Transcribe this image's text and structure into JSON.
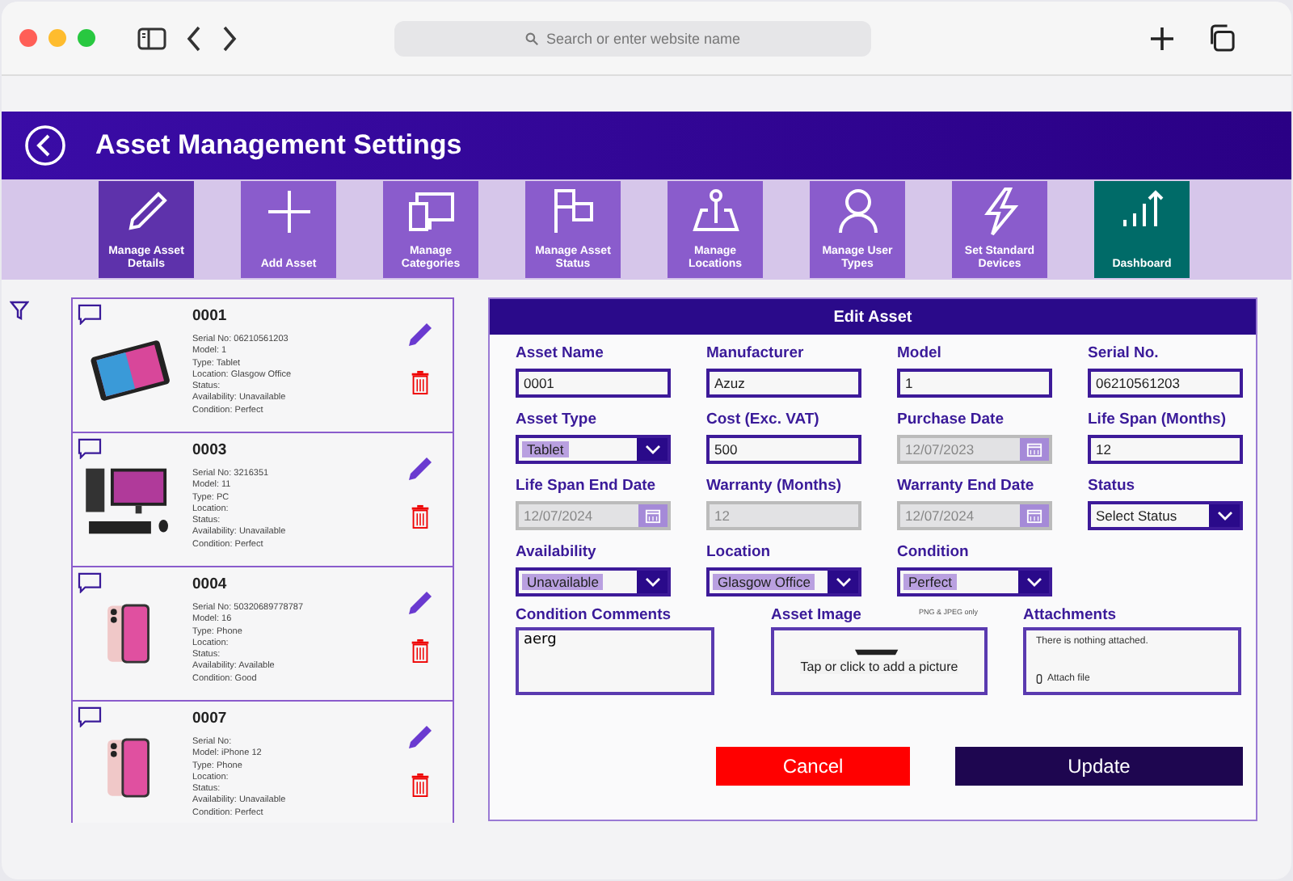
{
  "browser": {
    "address_placeholder": "Search or enter website name"
  },
  "header": {
    "title": "Asset Management Settings"
  },
  "nav": [
    {
      "label": "Manage Asset Details",
      "selected": true,
      "color": "#8a5ccc"
    },
    {
      "label": "Add Asset",
      "selected": false,
      "color": "#8a5ccc"
    },
    {
      "label": "Manage Categories",
      "selected": false,
      "color": "#8a5ccc"
    },
    {
      "label": "Manage Asset Status",
      "selected": false,
      "color": "#8a5ccc"
    },
    {
      "label": "Manage Locations",
      "selected": false,
      "color": "#8a5ccc"
    },
    {
      "label": "Manage User Types",
      "selected": false,
      "color": "#8a5ccc"
    },
    {
      "label": "Set Standard Devices",
      "selected": false,
      "color": "#8a5ccc"
    },
    {
      "label": "Dashboard",
      "selected": false,
      "color": "#006b68"
    }
  ],
  "assets": [
    {
      "id": "0001",
      "kind": "tablet",
      "details": [
        "Serial No: 06210561203",
        "Model: 1",
        "Type: Tablet",
        "Location: Glasgow Office",
        "Status:",
        "Availability: Unavailable",
        "Condition: Perfect"
      ]
    },
    {
      "id": "0003",
      "kind": "pc",
      "details": [
        "Serial No: 3216351",
        "Model: 11",
        "Type: PC",
        "Location:",
        "Status:",
        "Availability: Unavailable",
        "Condition: Perfect"
      ]
    },
    {
      "id": "0004",
      "kind": "phone",
      "details": [
        "Serial No: 50320689778787",
        "Model: 16",
        "Type: Phone",
        "Location:",
        "Status:",
        "Availability: Available",
        "Condition: Good"
      ]
    },
    {
      "id": "0007",
      "kind": "phone",
      "details": [
        "Serial No:",
        "Model: iPhone 12",
        "Type: Phone",
        "Location:",
        "Status:",
        "Availability: Unavailable",
        "Condition: Perfect"
      ]
    }
  ],
  "form": {
    "title": "Edit Asset",
    "fields": [
      {
        "label": "Asset Name",
        "value": "0001",
        "kind": "text",
        "disabled": false
      },
      {
        "label": "Manufacturer",
        "value": "Azuz",
        "kind": "text",
        "disabled": false
      },
      {
        "label": "Model",
        "value": "1",
        "kind": "text",
        "disabled": false
      },
      {
        "label": "Serial No.",
        "value": "06210561203",
        "kind": "text",
        "disabled": false
      },
      {
        "label": "Asset Type",
        "value": "Tablet",
        "kind": "dropdown",
        "disabled": false
      },
      {
        "label": "Cost (Exc. VAT)",
        "value": "500",
        "kind": "text",
        "disabled": false
      },
      {
        "label": "Purchase Date",
        "value": "12/07/2023",
        "kind": "date",
        "disabled": true
      },
      {
        "label": "Life Span (Months)",
        "value": "12",
        "kind": "text",
        "disabled": false
      },
      {
        "label": "Life Span End Date",
        "value": "12/07/2024",
        "kind": "date",
        "disabled": true
      },
      {
        "label": "Warranty (Months)",
        "value": "12",
        "kind": "text",
        "disabled": true
      },
      {
        "label": "Warranty End Date",
        "value": "12/07/2024",
        "kind": "date",
        "disabled": true
      },
      {
        "label": "Status",
        "placeholder": "Select Status",
        "kind": "dropdown",
        "disabled": false
      },
      {
        "label": "Availability",
        "value": "Unavailable",
        "kind": "dropdown",
        "disabled": false
      },
      {
        "label": "Location",
        "value": "Glasgow Office",
        "kind": "dropdown",
        "disabled": false
      },
      {
        "label": "Condition",
        "value": "Perfect",
        "kind": "dropdown",
        "disabled": false
      }
    ],
    "comments": {
      "label": "Condition Comments",
      "value": "aerg"
    },
    "image": {
      "label": "Asset Image",
      "note": "PNG & JPEG only",
      "prompt": "Tap or click to add a picture"
    },
    "attachments": {
      "label": "Attachments",
      "message": "There is nothing attached.",
      "action": "Attach file"
    },
    "buttons": [
      {
        "label": "Cancel",
        "kind": "cancel"
      },
      {
        "label": "Update",
        "kind": "primary"
      }
    ]
  }
}
